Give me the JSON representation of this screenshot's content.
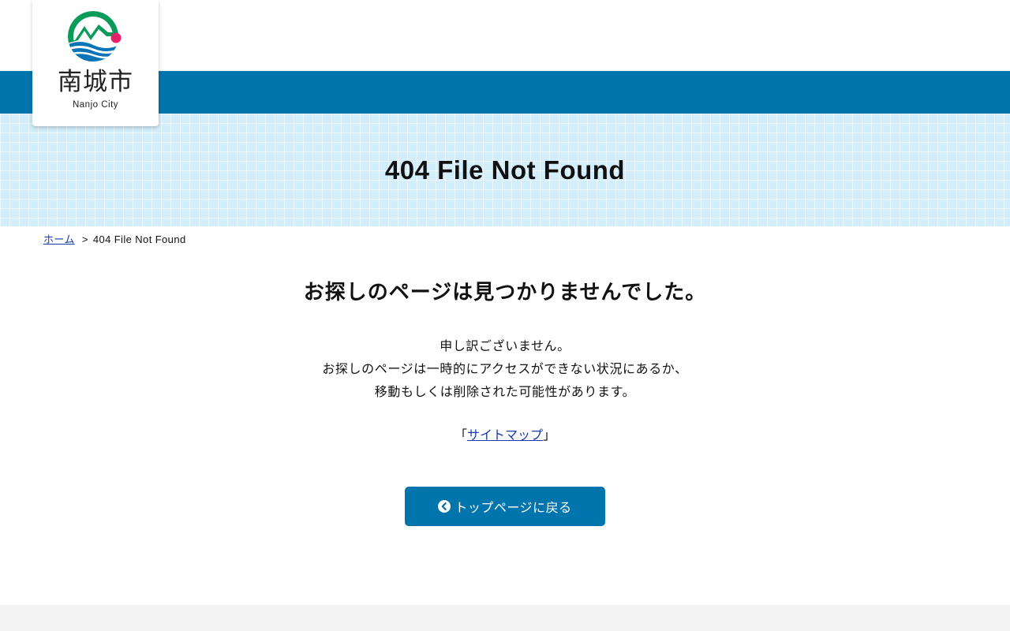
{
  "logo": {
    "name_jp": "南城市",
    "name_en": "Nanjo City",
    "colors": {
      "green": "#0a9a5a",
      "blue": "#0a74b6",
      "pink": "#e8226a"
    }
  },
  "header": {
    "bar_color": "#0075ad"
  },
  "title_band": {
    "title": "404 File Not Found"
  },
  "breadcrumb": {
    "home_label": "ホーム",
    "separator": ">",
    "current": "404 File Not Found"
  },
  "main": {
    "heading": "お探しのページは見つかりませんでした。",
    "message_lines": [
      "申し訳ございません。",
      "お探しのページは一時的にアクセスができない状況にあるか、",
      "移動もしくは削除された可能性があります。"
    ],
    "sitemap": {
      "open_bracket": "「",
      "label": "サイトマップ",
      "close_bracket": "」"
    },
    "back_button": {
      "label": "トップページに戻る",
      "icon": "chevron-left-circle-icon"
    }
  },
  "colors": {
    "accent": "#0075ad",
    "band": "#d3eefb",
    "link": "#1a3aa8",
    "footer": "#f4f4f4"
  }
}
